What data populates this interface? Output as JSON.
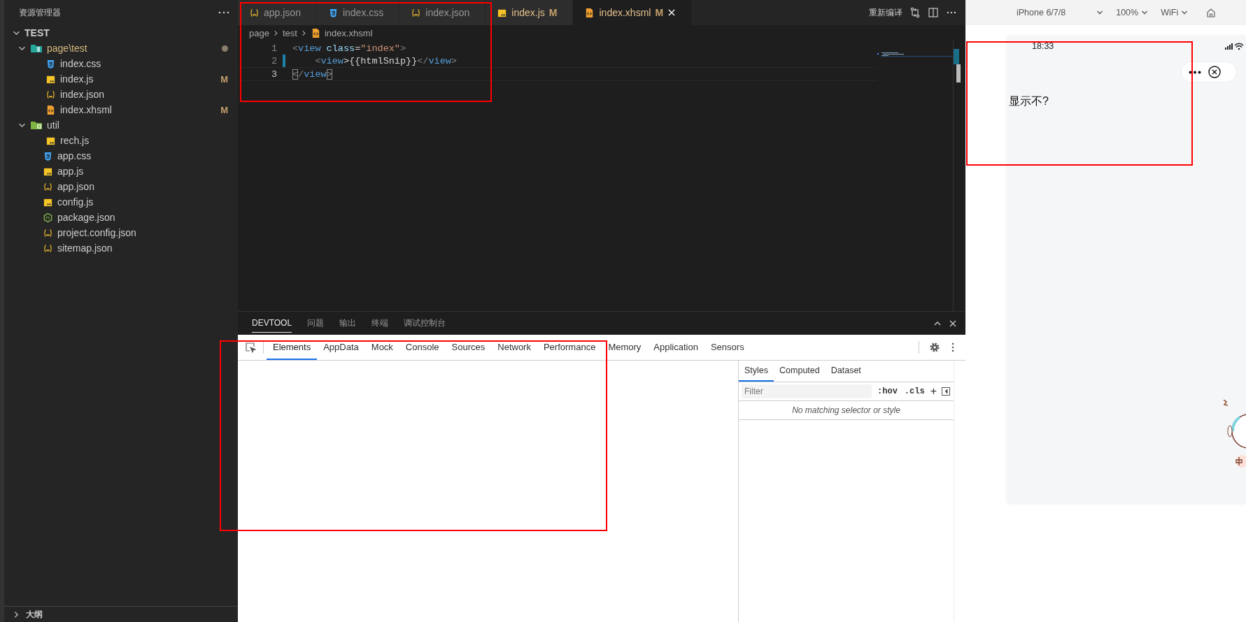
{
  "explorer": {
    "title": "资源管理器",
    "root": {
      "label": "TEST",
      "expanded": true,
      "children": [
        {
          "label": "page\\test",
          "kind": "folder-page",
          "expanded": true,
          "modified_dot": true,
          "children": [
            {
              "label": "index.css",
              "kind": "css"
            },
            {
              "label": "index.js",
              "kind": "js",
              "badge": "M"
            },
            {
              "label": "index.json",
              "kind": "json"
            },
            {
              "label": "index.xhsml",
              "kind": "xhsml",
              "badge": "M"
            }
          ]
        },
        {
          "label": "util",
          "kind": "folder-lib",
          "expanded": true,
          "children": [
            {
              "label": "rech.js",
              "kind": "js"
            }
          ]
        },
        {
          "label": "app.css",
          "kind": "css"
        },
        {
          "label": "app.js",
          "kind": "js"
        },
        {
          "label": "app.json",
          "kind": "json"
        },
        {
          "label": "config.js",
          "kind": "js"
        },
        {
          "label": "package.json",
          "kind": "node"
        },
        {
          "label": "project.config.json",
          "kind": "json"
        },
        {
          "label": "sitemap.json",
          "kind": "json"
        }
      ]
    },
    "outline": {
      "label": "大纲",
      "expanded": false
    }
  },
  "editor_tabs": [
    {
      "label": "app.json",
      "kind": "json",
      "selected": false
    },
    {
      "label": "index.css",
      "kind": "css",
      "selected": false
    },
    {
      "label": "index.json",
      "kind": "json",
      "selected": false
    },
    {
      "label": "index.js",
      "kind": "js",
      "badge": "M",
      "selected": false
    },
    {
      "label": "index.xhsml",
      "kind": "xhsml",
      "badge": "M",
      "selected": true
    }
  ],
  "editor_actions": {
    "recompile": "重新编译"
  },
  "breadcrumb": [
    {
      "label": "page"
    },
    {
      "label": "test"
    },
    {
      "label": "index.xhsml",
      "kind": "xhsml"
    }
  ],
  "code_lines": [
    {
      "number": "1",
      "current": false,
      "modified": false,
      "tokens": [
        {
          "text": "<",
          "kind": "punct"
        },
        {
          "text": "view",
          "kind": "tag"
        },
        {
          "text": " class",
          "kind": "attr"
        },
        {
          "text": "=",
          "kind": "plain"
        },
        {
          "text": "\"index\"",
          "kind": "string"
        },
        {
          "text": ">",
          "kind": "punct"
        }
      ]
    },
    {
      "number": "2",
      "current": false,
      "modified": true,
      "tokens": [
        {
          "text": "    <",
          "kind": "punct"
        },
        {
          "text": "view",
          "kind": "tag"
        },
        {
          "text": ">{{htmlSnip}}",
          "kind": "plain"
        },
        {
          "text": "</",
          "kind": "punct"
        },
        {
          "text": "view",
          "kind": "tag"
        },
        {
          "text": ">",
          "kind": "punct"
        }
      ]
    },
    {
      "number": "3",
      "current": true,
      "modified": false,
      "tokens": [
        {
          "text": "<",
          "kind": "match"
        },
        {
          "text": "/",
          "kind": "punct"
        },
        {
          "text": "view",
          "kind": "tag"
        },
        {
          "text": ">",
          "kind": "match"
        }
      ]
    }
  ],
  "panel_tabs": [
    {
      "label": "DEVTOOL",
      "selected": true
    },
    {
      "label": "问题",
      "selected": false
    },
    {
      "label": "输出",
      "selected": false
    },
    {
      "label": "终端",
      "selected": false
    },
    {
      "label": "调试控制台",
      "selected": false
    }
  ],
  "devtools_tabs": [
    {
      "label": "Elements",
      "selected": true
    },
    {
      "label": "AppData",
      "selected": false
    },
    {
      "label": "Mock",
      "selected": false
    },
    {
      "label": "Console",
      "selected": false
    },
    {
      "label": "Sources",
      "selected": false
    },
    {
      "label": "Network",
      "selected": false
    },
    {
      "label": "Performance",
      "selected": false
    },
    {
      "label": "Memory",
      "selected": false
    },
    {
      "label": "Application",
      "selected": false
    },
    {
      "label": "Sensors",
      "selected": false
    }
  ],
  "styles_pane": {
    "tabs": [
      {
        "label": "Styles",
        "selected": true
      },
      {
        "label": "Computed",
        "selected": false
      },
      {
        "label": "Dataset",
        "selected": false
      }
    ],
    "filter": {
      "placeholder": "Filter"
    },
    "hov": ":hov",
    "cls": ".cls",
    "add": "+",
    "message": "No matching selector or style"
  },
  "simulator": {
    "device": "iPhone 6/7/8",
    "zoom": "100%",
    "network": "WiFi",
    "time": "18:33",
    "content": "显示不?"
  }
}
